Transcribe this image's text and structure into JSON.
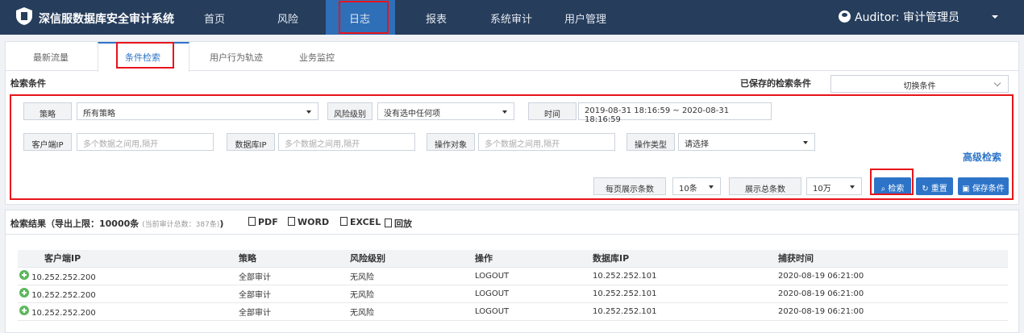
{
  "app": {
    "title": "深信服数据库安全审计系统"
  },
  "nav": {
    "items": [
      "首页",
      "风险",
      "日志",
      "报表",
      "系统审计",
      "用户管理"
    ]
  },
  "user": {
    "label": "Auditor: 审计管理员"
  },
  "tabs": [
    "最新流量",
    "条件检索",
    "用户行为轨迹",
    "业务监控"
  ],
  "search": {
    "title": "检索条件",
    "saved_label": "已保存的检索条件",
    "saved_select": "切换条件",
    "strategy_label": "策略",
    "strategy_value": "所有策略",
    "risk_label": "风险级别",
    "risk_value": "没有选中任何项",
    "time_label": "时间",
    "time_value": "2019-08-31 18:16:59 ~ 2020-08-31 18:16:59",
    "client_ip_label": "客户端IP",
    "db_ip_label": "数据库IP",
    "target_label": "操作对象",
    "placeholder": "多个数据之间用,隔开",
    "op_type_label": "操作类型",
    "op_type_value": "请选择",
    "advanced": "高级检索",
    "per_page_label": "每页展示条数",
    "per_page_value": "10条",
    "total_label": "展示总条数",
    "total_value": "10万",
    "btn_search": "检索",
    "btn_reset": "重置",
    "btn_save": "保存条件"
  },
  "results": {
    "title": "检索结果（导出上限：10000条",
    "count_note": "(当前审计总数：387条)",
    "title_end": ")",
    "export": [
      "PDF",
      "WORD",
      "EXCEL",
      "回放"
    ],
    "columns": [
      "客户端IP",
      "策略",
      "风险级别",
      "操作",
      "数据库IP",
      "捕获时间"
    ],
    "rows": [
      [
        "10.252.252.200",
        "全部审计",
        "无风险",
        "LOGOUT",
        "10.252.252.101",
        "2020-08-19 06:21:00"
      ],
      [
        "10.252.252.200",
        "全部审计",
        "无风险",
        "LOGOUT",
        "10.252.252.101",
        "2020-08-19 06:21:00"
      ],
      [
        "10.252.252.200",
        "全部审计",
        "无风险",
        "LOGOUT",
        "10.252.252.101",
        "2020-08-19 06:21:00"
      ]
    ]
  },
  "colors": {
    "topbar": "#263d5c",
    "accent": "#2d74c8",
    "highlight": "#e8141b"
  }
}
